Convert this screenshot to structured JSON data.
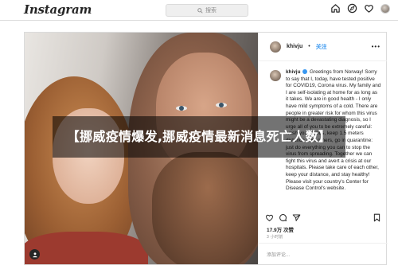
{
  "nav": {
    "logo": "Instagram",
    "search_placeholder": "搜索",
    "icons": [
      "home-icon",
      "compass-icon",
      "heart-icon",
      "profile-avatar"
    ]
  },
  "post": {
    "username": "khivju",
    "dot": "•",
    "follow_label": "关注",
    "more_label": "•••",
    "caption_user": "khivju",
    "caption_text": "Greetings from Norway! Sorry to say that I, today, have tested positive for COVID19, Corona virus. My family and I are self-isolating at home for as long as it takes. We are in good health - I only have mild symptoms of a cold. There are people in greater risk for whom this virus might be a devastating diagnosis, so I urge all of you to be extremely careful: wash your hands, keep 1.5 meters distance from others, go in quarantine: just do everything you can to stop the virus from spreading. Together we can fight this virus and avert a crisis at our hospitals. Please take care of each other, keep your distance, and stay healthy! Please visit your country's Center for Disease Control's website.",
    "likes": "17.9万 次赞",
    "date": "3 小时前",
    "comment_placeholder": "添加评论..."
  },
  "banner": {
    "text": "【挪威疫情爆发,挪威疫情最新消息死亡人数】"
  },
  "colors": {
    "link": "#3897f0",
    "border": "#dbdbdb",
    "text": "#262626",
    "muted": "#8e8e8e"
  }
}
